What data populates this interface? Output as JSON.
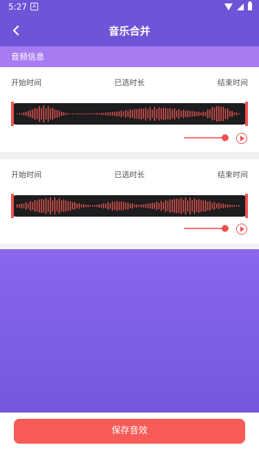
{
  "status_bar": {
    "time": "5:27",
    "notification_icon": "a-icon"
  },
  "nav": {
    "title": "音乐合并",
    "back_icon": "chevron-left-icon"
  },
  "section": {
    "title": "音频信息"
  },
  "cards": [
    {
      "start_label": "开始时间",
      "selected_label": "已选时长",
      "end_label": "结束时间"
    },
    {
      "start_label": "开始时间",
      "selected_label": "已选时长",
      "end_label": "结束时间"
    }
  ],
  "save_button": {
    "label": "保存音效"
  },
  "colors": {
    "header": "#6e55d8",
    "section": "#a77cf2",
    "accent": "#f85c58",
    "waveform_bg": "#1d1c1f"
  }
}
